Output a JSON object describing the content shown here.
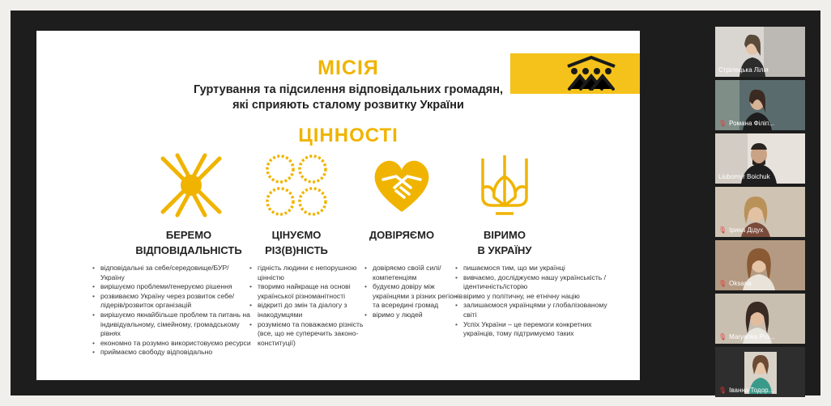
{
  "slide": {
    "mission_heading": "МІСІЯ",
    "mission_line1": "Гуртування та підсилення відповідальних громадян,",
    "mission_line2": "які сприяють сталому розвитку України",
    "values_heading": "ЦІННОСТІ",
    "values": [
      {
        "icon": "hands-together-icon",
        "title_line1": "БЕРЕМО",
        "title_line2": "ВІДПОВІДАЛЬНІСТЬ",
        "items": [
          "відповідальні за себе/середовище/БУР/Україну",
          "вирішуємо проблеми/генеруємо рішення",
          "розвиваємо Україну через розвиток себе/лідерів/розвиток організацій",
          "вирішуємо якнайбільше проблем та питань на індивідуальному, сімейному, громадському рівнях",
          "економно та розумно використовуємо ресурси",
          "приймаємо свободу відповідально"
        ]
      },
      {
        "icon": "four-circles-icon",
        "title_line1": "ЦІНУЄМО",
        "title_line2": "РІЗ(В)НІСТЬ",
        "items": [
          "гідність людини є непорушною цінністю",
          "творимо найкраще на основі української різноманітності",
          "відкриті до змін та діалогу з інакодумцями",
          "розуміємо та поважаємо різність (все, що не суперечить законо-конституції)"
        ]
      },
      {
        "icon": "heart-handshake-icon",
        "title_line1": "ДОВІРЯЄМО",
        "title_line2": "",
        "items": [
          "довіряємо своїй силі/компетенціям",
          "будуємо довіру між українцями з різних регіонів та всередині громад",
          "віримо у людей"
        ]
      },
      {
        "icon": "trident-icon",
        "title_line1": "ВІРИМО",
        "title_line2": "В УКРАЇНУ",
        "items": [
          "пишаємося тим, що ми українці",
          "вивчаємо, досліджуємо нашу українськість /ідентичність/історію",
          "віримо у політичну, не етнічну націю",
          "залишаємося українцями у глобалізованому світі",
          "Успіх України – це перемоги конкретних українців, тому підтримуємо таких"
        ]
      }
    ]
  },
  "participants": [
    {
      "name": "Стрілецька Лілія",
      "muted": false,
      "active": false
    },
    {
      "name": "Романа Філіп...",
      "muted": true,
      "active": false
    },
    {
      "name": "Liubomyr Boichuk",
      "muted": false,
      "active": true
    },
    {
      "name": "Ірина Дідух",
      "muted": true,
      "active": false
    },
    {
      "name": "Oksana",
      "muted": true,
      "active": false
    },
    {
      "name": "Maryanka Pro...",
      "muted": true,
      "active": false
    },
    {
      "name": "Іванна Тодор...",
      "muted": true,
      "active": false
    }
  ],
  "colors": {
    "accent": "#f0b400",
    "band": "#f4c21a",
    "active_speaker": "#c8e35a",
    "muted_icon": "#e23b3b"
  }
}
